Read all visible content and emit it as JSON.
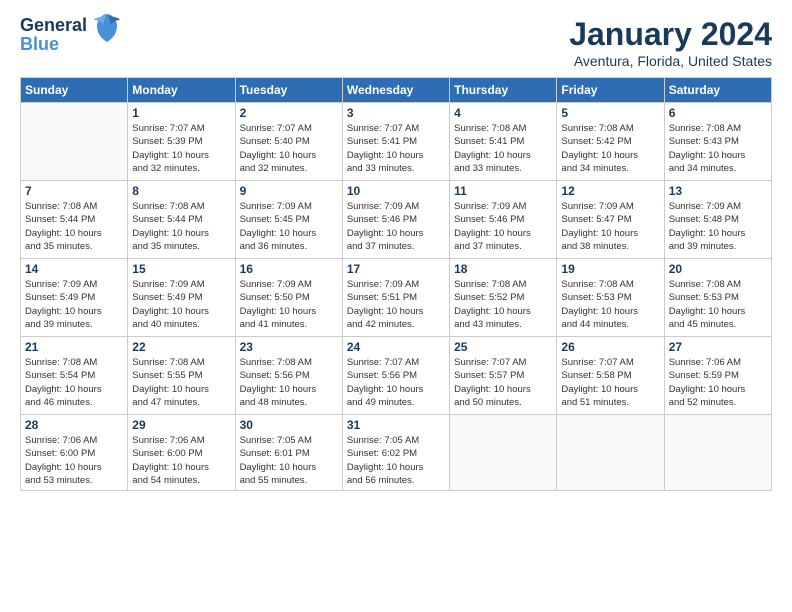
{
  "logo": {
    "line1": "General",
    "line2": "Blue"
  },
  "title": "January 2024",
  "location": "Aventura, Florida, United States",
  "weekdays": [
    "Sunday",
    "Monday",
    "Tuesday",
    "Wednesday",
    "Thursday",
    "Friday",
    "Saturday"
  ],
  "weeks": [
    [
      {
        "day": "",
        "info": ""
      },
      {
        "day": "1",
        "info": "Sunrise: 7:07 AM\nSunset: 5:39 PM\nDaylight: 10 hours\nand 32 minutes."
      },
      {
        "day": "2",
        "info": "Sunrise: 7:07 AM\nSunset: 5:40 PM\nDaylight: 10 hours\nand 32 minutes."
      },
      {
        "day": "3",
        "info": "Sunrise: 7:07 AM\nSunset: 5:41 PM\nDaylight: 10 hours\nand 33 minutes."
      },
      {
        "day": "4",
        "info": "Sunrise: 7:08 AM\nSunset: 5:41 PM\nDaylight: 10 hours\nand 33 minutes."
      },
      {
        "day": "5",
        "info": "Sunrise: 7:08 AM\nSunset: 5:42 PM\nDaylight: 10 hours\nand 34 minutes."
      },
      {
        "day": "6",
        "info": "Sunrise: 7:08 AM\nSunset: 5:43 PM\nDaylight: 10 hours\nand 34 minutes."
      }
    ],
    [
      {
        "day": "7",
        "info": "Sunrise: 7:08 AM\nSunset: 5:44 PM\nDaylight: 10 hours\nand 35 minutes."
      },
      {
        "day": "8",
        "info": "Sunrise: 7:08 AM\nSunset: 5:44 PM\nDaylight: 10 hours\nand 35 minutes."
      },
      {
        "day": "9",
        "info": "Sunrise: 7:09 AM\nSunset: 5:45 PM\nDaylight: 10 hours\nand 36 minutes."
      },
      {
        "day": "10",
        "info": "Sunrise: 7:09 AM\nSunset: 5:46 PM\nDaylight: 10 hours\nand 37 minutes."
      },
      {
        "day": "11",
        "info": "Sunrise: 7:09 AM\nSunset: 5:46 PM\nDaylight: 10 hours\nand 37 minutes."
      },
      {
        "day": "12",
        "info": "Sunrise: 7:09 AM\nSunset: 5:47 PM\nDaylight: 10 hours\nand 38 minutes."
      },
      {
        "day": "13",
        "info": "Sunrise: 7:09 AM\nSunset: 5:48 PM\nDaylight: 10 hours\nand 39 minutes."
      }
    ],
    [
      {
        "day": "14",
        "info": "Sunrise: 7:09 AM\nSunset: 5:49 PM\nDaylight: 10 hours\nand 39 minutes."
      },
      {
        "day": "15",
        "info": "Sunrise: 7:09 AM\nSunset: 5:49 PM\nDaylight: 10 hours\nand 40 minutes."
      },
      {
        "day": "16",
        "info": "Sunrise: 7:09 AM\nSunset: 5:50 PM\nDaylight: 10 hours\nand 41 minutes."
      },
      {
        "day": "17",
        "info": "Sunrise: 7:09 AM\nSunset: 5:51 PM\nDaylight: 10 hours\nand 42 minutes."
      },
      {
        "day": "18",
        "info": "Sunrise: 7:08 AM\nSunset: 5:52 PM\nDaylight: 10 hours\nand 43 minutes."
      },
      {
        "day": "19",
        "info": "Sunrise: 7:08 AM\nSunset: 5:53 PM\nDaylight: 10 hours\nand 44 minutes."
      },
      {
        "day": "20",
        "info": "Sunrise: 7:08 AM\nSunset: 5:53 PM\nDaylight: 10 hours\nand 45 minutes."
      }
    ],
    [
      {
        "day": "21",
        "info": "Sunrise: 7:08 AM\nSunset: 5:54 PM\nDaylight: 10 hours\nand 46 minutes."
      },
      {
        "day": "22",
        "info": "Sunrise: 7:08 AM\nSunset: 5:55 PM\nDaylight: 10 hours\nand 47 minutes."
      },
      {
        "day": "23",
        "info": "Sunrise: 7:08 AM\nSunset: 5:56 PM\nDaylight: 10 hours\nand 48 minutes."
      },
      {
        "day": "24",
        "info": "Sunrise: 7:07 AM\nSunset: 5:56 PM\nDaylight: 10 hours\nand 49 minutes."
      },
      {
        "day": "25",
        "info": "Sunrise: 7:07 AM\nSunset: 5:57 PM\nDaylight: 10 hours\nand 50 minutes."
      },
      {
        "day": "26",
        "info": "Sunrise: 7:07 AM\nSunset: 5:58 PM\nDaylight: 10 hours\nand 51 minutes."
      },
      {
        "day": "27",
        "info": "Sunrise: 7:06 AM\nSunset: 5:59 PM\nDaylight: 10 hours\nand 52 minutes."
      }
    ],
    [
      {
        "day": "28",
        "info": "Sunrise: 7:06 AM\nSunset: 6:00 PM\nDaylight: 10 hours\nand 53 minutes."
      },
      {
        "day": "29",
        "info": "Sunrise: 7:06 AM\nSunset: 6:00 PM\nDaylight: 10 hours\nand 54 minutes."
      },
      {
        "day": "30",
        "info": "Sunrise: 7:05 AM\nSunset: 6:01 PM\nDaylight: 10 hours\nand 55 minutes."
      },
      {
        "day": "31",
        "info": "Sunrise: 7:05 AM\nSunset: 6:02 PM\nDaylight: 10 hours\nand 56 minutes."
      },
      {
        "day": "",
        "info": ""
      },
      {
        "day": "",
        "info": ""
      },
      {
        "day": "",
        "info": ""
      }
    ]
  ]
}
